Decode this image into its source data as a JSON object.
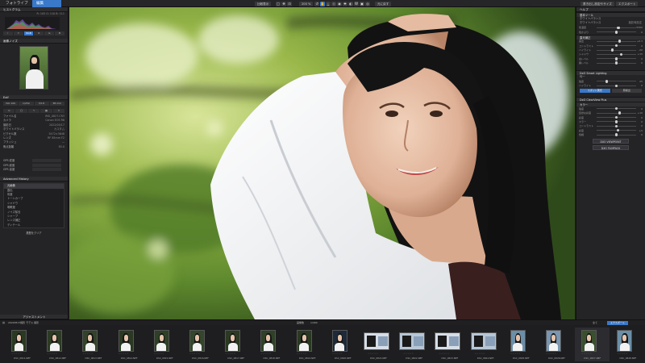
{
  "topbar": {
    "tab_library": "フォトライブラリ",
    "tab_edit": "編集",
    "compare_btn": "比較表示",
    "zoom": "200 %",
    "history_btn": "元に戻す",
    "export_top_btn": "エクスポート",
    "export_settings_btn": "書き出し設定やサイズ"
  },
  "left": {
    "histogram_title": "ヒストグラム",
    "histogram_info": "R: 105 G: 110 B: 111",
    "preview_title": "画像ノイズ",
    "exif_title": "Exif",
    "exif_chips": [
      "ISO 100",
      "1/250",
      "f/2.8",
      "85 mm"
    ],
    "info_rows": [
      {
        "label": "ファイル名",
        "value": "IMG_0827.CR3"
      },
      {
        "label": "カメラ",
        "value": "Canon EOS R6"
      },
      {
        "label": "撮影日",
        "value": "2022/05/17"
      },
      {
        "label": "ホワイトバランス",
        "value": "カスタム"
      },
      {
        "label": "ピクセル数",
        "value": "5472×3648"
      },
      {
        "label": "レンズ",
        "value": "RF 85mm F2"
      },
      {
        "label": "フラッシュ",
        "value": "—"
      },
      {
        "label": "焦点距離",
        "value": "85.0"
      }
    ],
    "gps_rows": [
      "GPS 緯度",
      "GPS 経度",
      "GPS 高度"
    ],
    "history_title": "Advanced History",
    "history_items": [
      "元画像",
      "露出",
      "彩度",
      "トーンカーブ",
      "シャドウ",
      "明瞭度",
      "ノイズ除去",
      "シャープ",
      "レンズ補正",
      "ディテール"
    ],
    "history_footer": "履歴をクリア",
    "bottom_label": "アジャストメント"
  },
  "right": {
    "header": "ヘルプ",
    "basic_title": "基本ツール",
    "basic_sub": "ホワイトバランス",
    "wb_label": "ホワイトバランス",
    "wb_value": "撮影時設定",
    "sliders_a": [
      {
        "label": "色温度",
        "value": "5200",
        "pos": 0.55
      },
      {
        "label": "色かぶり",
        "value": "0",
        "pos": 0.5
      }
    ],
    "exposure_title": "露光補正",
    "sliders_b": [
      {
        "label": "露出",
        "value": "+0.3",
        "pos": 0.58
      },
      {
        "label": "コントラスト",
        "value": "0",
        "pos": 0.5
      },
      {
        "label": "ハイライト",
        "value": "-20",
        "pos": 0.4
      },
      {
        "label": "シャドウ",
        "value": "+15",
        "pos": 0.62
      },
      {
        "label": "白レベル",
        "value": "0",
        "pos": 0.5
      },
      {
        "label": "黒レベル",
        "value": "0",
        "pos": 0.5
      }
    ],
    "smart_lighting": "DxO Smart Lighting",
    "smart_mode": "均一",
    "sliders_c": [
      {
        "label": "強度",
        "value": "25",
        "pos": 0.25
      },
      {
        "label": "ハイライト",
        "value": "0",
        "pos": 0.5
      }
    ],
    "smart_btn_a": "スポット測光",
    "smart_btn_b": "顔検出",
    "clearview_title": "DxO ClearView Plus",
    "color_title": "カラー",
    "sliders_d": [
      {
        "label": "強度",
        "value": "0",
        "pos": 0.5
      },
      {
        "label": "自然な彩度",
        "value": "+10",
        "pos": 0.58
      },
      {
        "label": "彩度",
        "value": "0",
        "pos": 0.5
      },
      {
        "label": "カラー",
        "value": "0",
        "pos": 0.5
      },
      {
        "label": "コントラスト",
        "value": "0",
        "pos": 0.5
      },
      {
        "label": "彩度",
        "value": "+5",
        "pos": 0.54
      },
      {
        "label": "色相",
        "value": "0",
        "pos": 0.5
      }
    ],
    "viewpoint": "DXO VIEWPOINT",
    "filmpack": "DXO FILMPACK"
  },
  "filmbar": {
    "path": "20220517撮影 モデル 撮影",
    "count_label": "画像数",
    "count": "1/404",
    "filter": "全て",
    "export_btn": "エクスポート"
  },
  "thumbnails": [
    {
      "name": "DSC_0811.NEF",
      "landscape": false,
      "tone": "#2a3a22"
    },
    {
      "name": "DSC_0812.NEF",
      "landscape": false,
      "tone": "#2c3c24"
    },
    {
      "name": "DSC_0813.NEF",
      "landscape": false,
      "tone": "#33422a"
    },
    {
      "name": "DSC_0814.NEF",
      "landscape": false,
      "tone": "#2a3a22"
    },
    {
      "name": "DSC_0815.NEF",
      "landscape": false,
      "tone": "#2e4026"
    },
    {
      "name": "DSC_0816.NEF",
      "landscape": false,
      "tone": "#34462b"
    },
    {
      "name": "DSC_0817.NEF",
      "landscape": false,
      "tone": "#2b3b23"
    },
    {
      "name": "DSC_0818.NEF",
      "landscape": false,
      "tone": "#2f4127"
    },
    {
      "name": "DSC_0819.NEF",
      "landscape": false,
      "tone": "#2a3a22"
    },
    {
      "name": "DSC_0820.NEF",
      "landscape": false,
      "tone": "#1e2a3a"
    },
    {
      "name": "DSC_0821.NEF",
      "landscape": true,
      "tone": "#d6dde6"
    },
    {
      "name": "DSC_0822.NEF",
      "landscape": true,
      "tone": "#b7c6d6"
    },
    {
      "name": "DSC_0823.NEF",
      "landscape": true,
      "tone": "#d6dde6"
    },
    {
      "name": "DSC_0824.NEF",
      "landscape": true,
      "tone": "#b7c6d6"
    },
    {
      "name": "DSC_0825.NEF",
      "landscape": false,
      "tone": "#6c8fa8"
    },
    {
      "name": "DSC_0826.NEF",
      "landscape": false,
      "tone": "#7a96b0"
    },
    {
      "name": "DSC_0827.NEF",
      "landscape": false,
      "tone": "#3a4f2e"
    },
    {
      "name": "DSC_0828.NEF",
      "landscape": false,
      "tone": "#6c8fa8"
    }
  ],
  "colors": {
    "accent": "#3a78c9",
    "panel": "#242426",
    "background": "#1c1c1e"
  }
}
